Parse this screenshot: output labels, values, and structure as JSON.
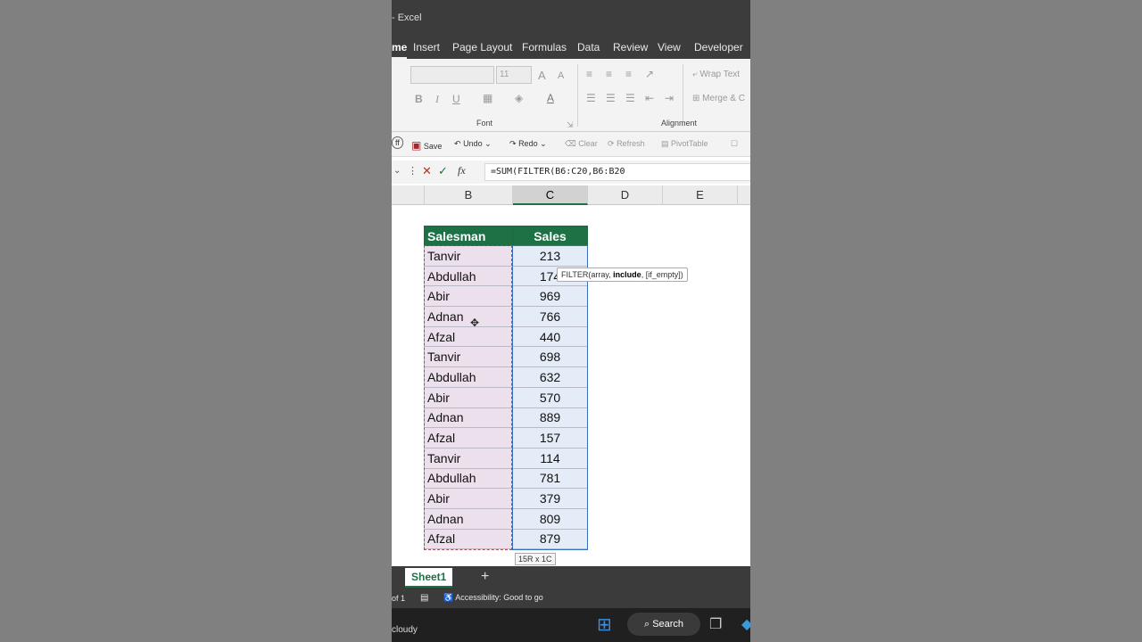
{
  "titlebar": {
    "app_title": "- Excel"
  },
  "ribbon_tabs": [
    {
      "label": "me",
      "active": true
    },
    {
      "label": "Insert"
    },
    {
      "label": "Page Layout"
    },
    {
      "label": "Formulas"
    },
    {
      "label": "Data"
    },
    {
      "label": "Review"
    },
    {
      "label": "View"
    },
    {
      "label": "Developer"
    }
  ],
  "ribbon": {
    "font_size": "11",
    "font_group_label": "Font",
    "alignment_group_label": "Alignment",
    "wrap_text": "Wrap Text",
    "merge_center": "Merge & C",
    "bold": "B",
    "italic": "I",
    "underline": "U",
    "grow_font": "A",
    "shrink_font": "A"
  },
  "qat": {
    "autosave": "ff",
    "save": "Save",
    "undo": "Undo",
    "redo": "Redo",
    "clear": "Clear",
    "refresh": "Refresh",
    "pivottable": "PivotTable"
  },
  "formula_bar": {
    "fx": "fx",
    "formula": "=SUM(FILTER(B6:C20,B6:B20"
  },
  "columns": [
    "B",
    "C",
    "D",
    "E"
  ],
  "table": {
    "headers": [
      "Salesman",
      "Sales"
    ],
    "rows": [
      [
        "Tanvir",
        "213"
      ],
      [
        "Abdullah",
        "174"
      ],
      [
        "Abir",
        "969"
      ],
      [
        "Adnan",
        "766"
      ],
      [
        "Afzal",
        "440"
      ],
      [
        "Tanvir",
        "698"
      ],
      [
        "Abdullah",
        "632"
      ],
      [
        "Abir",
        "570"
      ],
      [
        "Adnan",
        "889"
      ],
      [
        "Afzal",
        "157"
      ],
      [
        "Tanvir",
        "114"
      ],
      [
        "Abdullah",
        "781"
      ],
      [
        "Abir",
        "379"
      ],
      [
        "Adnan",
        "809"
      ],
      [
        "Afzal",
        "879"
      ]
    ]
  },
  "tooltip": {
    "prefix": "FILTER(array, ",
    "bold": "include",
    "suffix": ", [if_empty])"
  },
  "selection_size": "15R x 1C",
  "sheet_tab": "Sheet1",
  "add_sheet": "+",
  "status": {
    "page": "of 1",
    "accessibility": "Accessibility: Good to go"
  },
  "taskbar": {
    "weather": "cloudy",
    "search": "Search"
  },
  "colors": {
    "excel_green": "#1e7145",
    "name_fill": "#ece0ec",
    "value_fill": "#e3ecf7"
  }
}
